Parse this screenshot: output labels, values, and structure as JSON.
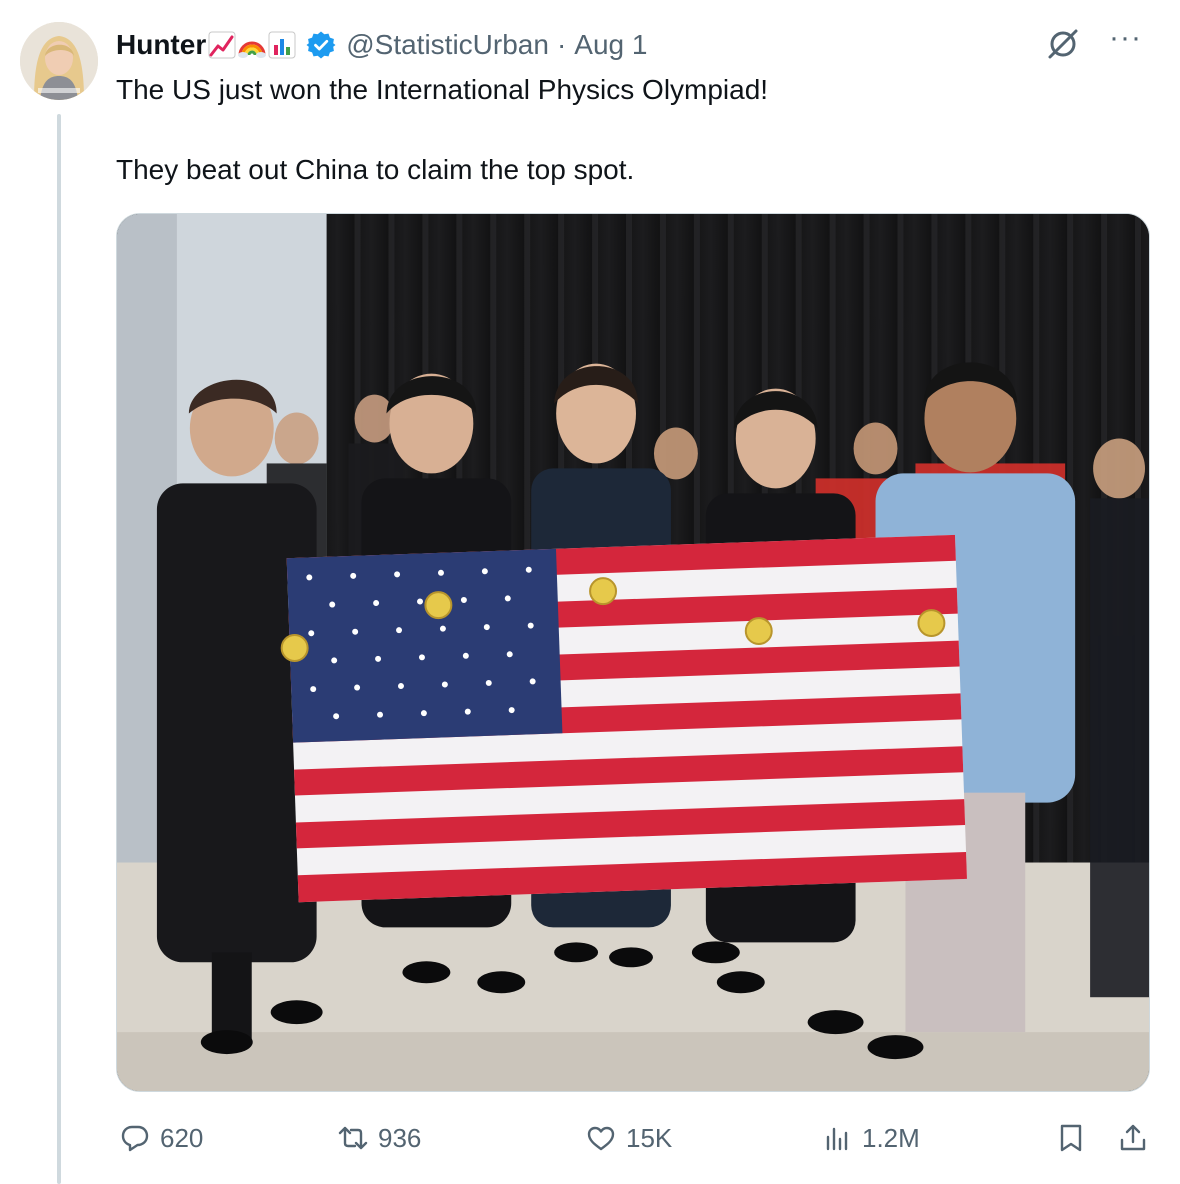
{
  "tweet": {
    "author": {
      "display_name": "Hunter",
      "emojis": [
        "chart-increasing-icon",
        "rainbow-icon",
        "bar-chart-icon"
      ],
      "verified": true,
      "handle": "@StatisticUrban",
      "date": "Aug 1"
    },
    "text": [
      "The US just won the International Physics Olympiad!",
      "They beat out China to claim the top spot."
    ],
    "media": {
      "type": "photo",
      "subject": "team-with-american-flag"
    },
    "stats": {
      "replies": "620",
      "retweets": "936",
      "likes": "15K",
      "views": "1.2M"
    },
    "colors": {
      "text": "#0f1419",
      "secondary": "#536471",
      "verified": "#1d9bf0",
      "border": "#cfd9de"
    }
  }
}
